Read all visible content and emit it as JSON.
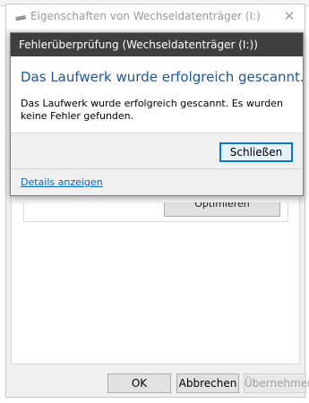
{
  "properties_window": {
    "title": "Eigenschaften von Wechseldatenträger (I:)",
    "close_glyph": "✕",
    "optimize_button_label": "Optimieren",
    "buttons": {
      "ok": "OK",
      "cancel": "Abbrechen",
      "apply": "Übernehmen"
    }
  },
  "error_check_dialog": {
    "title": "Fehlerüberprüfung (Wechseldatenträger (I:))",
    "heading": "Das Laufwerk wurde erfolgreich gescannt.",
    "message": "Das Laufwerk wurde erfolgreich gescannt. Es wurden keine Fehler gefunden.",
    "close_button": "Schließen",
    "details_link": "Details anzeigen"
  },
  "icons": {
    "drive": "removable-drive-icon",
    "close": "close-icon"
  },
  "colors": {
    "dialog_titlebar": "#3f3f3f",
    "heading_blue": "#1e56a0",
    "link_blue": "#0066cc",
    "focus_border": "#0078d7"
  }
}
